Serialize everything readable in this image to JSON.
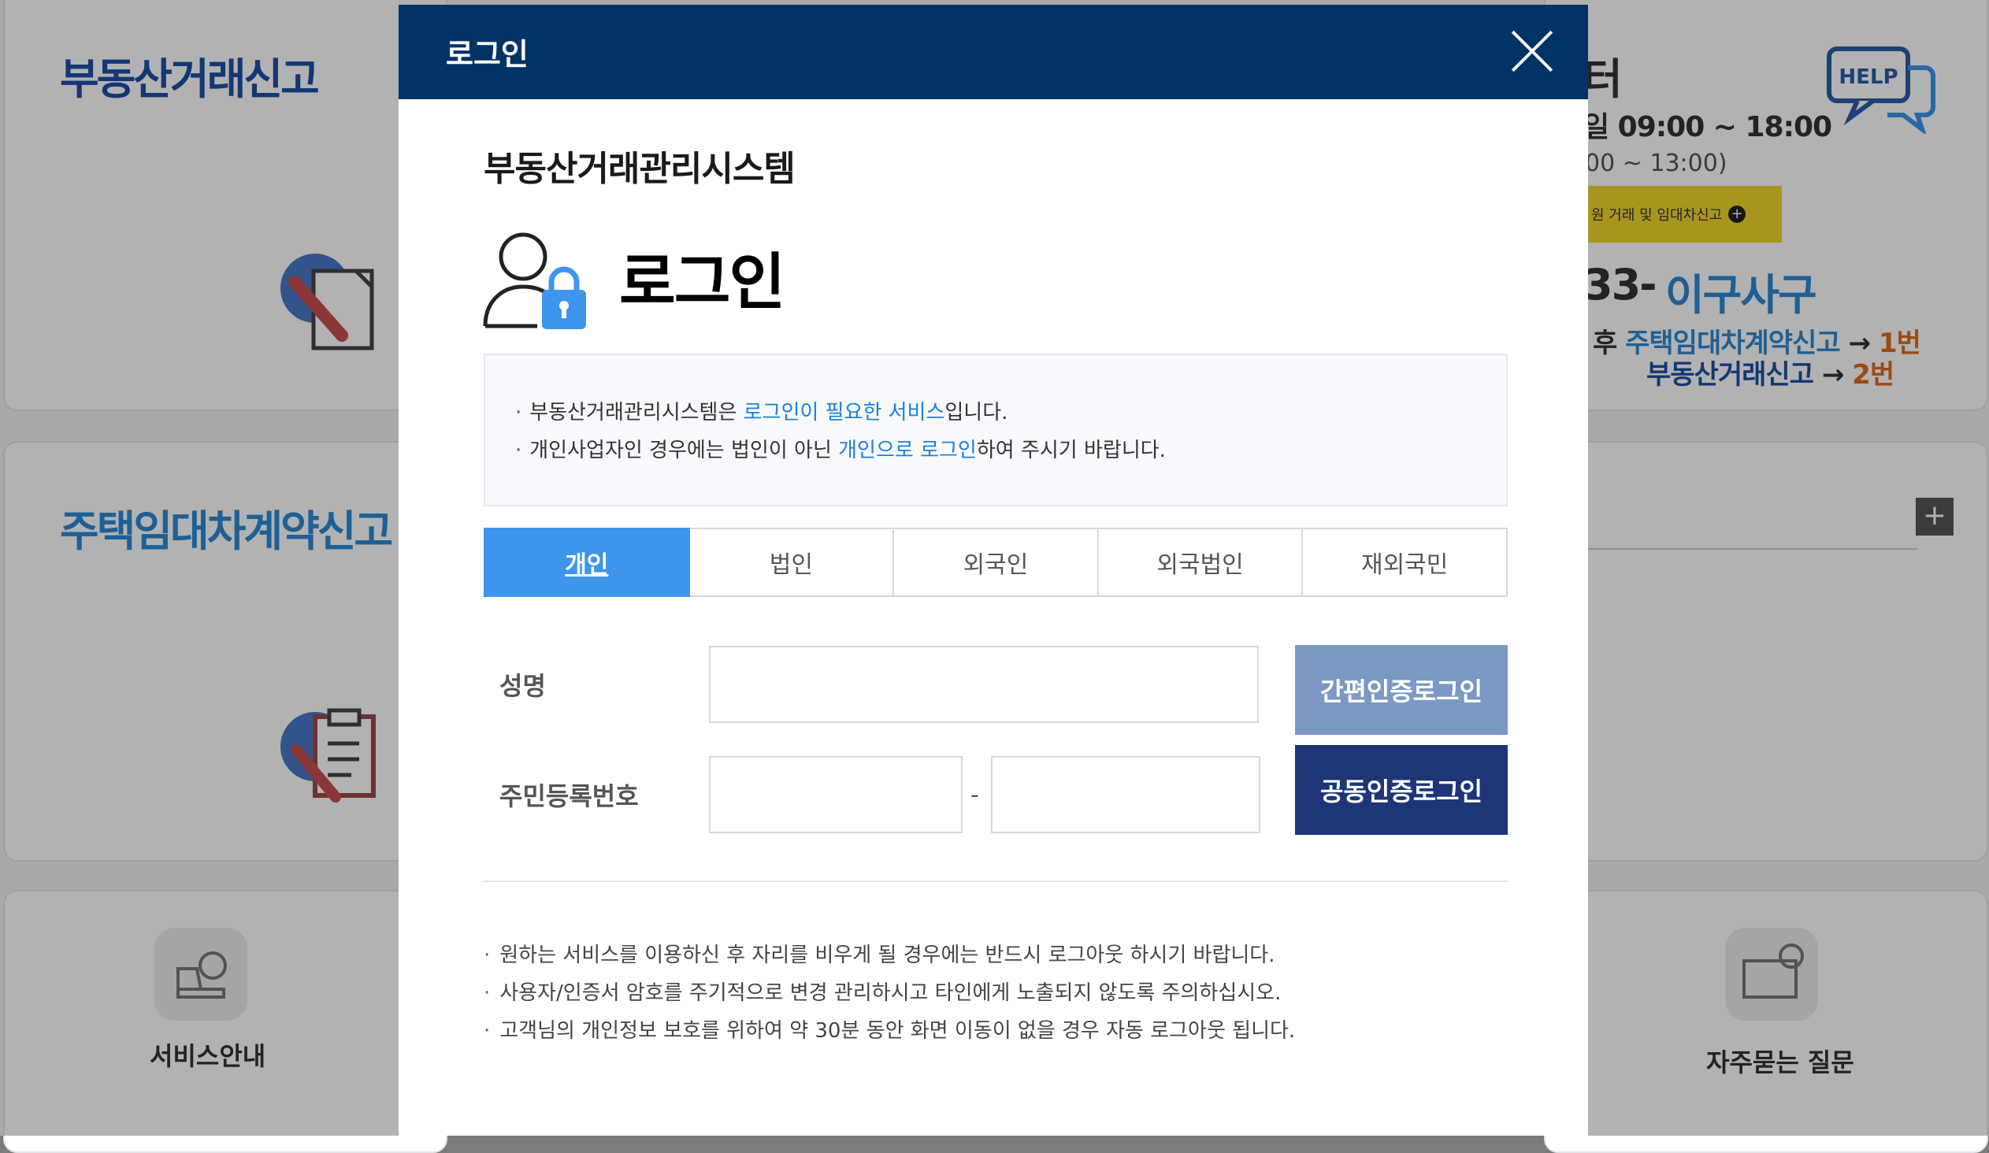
{
  "background": {
    "left_titles": [
      "부동산거래신고",
      "주택임대차계약신고"
    ],
    "help": {
      "partial_title": "터",
      "hours_line": "일 09:00 ~ 18:00",
      "lunch_line": "00 ~ 13:00)",
      "yellow_banner": "원 거래 및 임대차신고",
      "help_badge": "HELP"
    },
    "phone": {
      "number": "33-",
      "slogan": "이구사구",
      "line1_prefix": "후",
      "line1_link": "주택임대차계약신고",
      "line1_arrow": "→",
      "line1_num": "1번",
      "line2_link": "부동산거래신고",
      "line2_arrow": "→",
      "line2_num": "2번"
    },
    "plus_button": "+",
    "bottom_labels": [
      "서비스안내",
      "자주묻는 질문"
    ]
  },
  "modal": {
    "header_title": "로그인",
    "system_name": "부동산거래관리시스템",
    "big_title": "로그인",
    "notice": [
      {
        "dot": "·",
        "before": "부동산거래관리시스템은 ",
        "highlight": "로그인이 필요한 서비스",
        "after": "입니다."
      },
      {
        "dot": "·",
        "before": "개인사업자인 경우에는 법인이 아닌 ",
        "highlight": "개인으로 로그인",
        "after": "하여 주시기 바랍니다."
      }
    ],
    "tabs": [
      "개인",
      "법인",
      "외국인",
      "외국법인",
      "재외국민"
    ],
    "form": {
      "name_label": "성명",
      "rrn_label": "주민등록번호",
      "dash": "-"
    },
    "buttons": {
      "simple_cert": "간편인증로그인",
      "joint_cert": "공동인증로그인"
    },
    "footer_notes": [
      "원하는 서비스를 이용하신 후 자리를 비우게 될 경우에는 반드시 로그아웃 하시기 바랍니다.",
      "사용자/인증서 암호를 주기적으로 변경 관리하시고 타인에게 노출되지 않도록 주의하십시오.",
      "고객님의 개인정보 보호를 위하여 약 30분 동안 화면 이동이 없을 경우 자동 로그아웃 됩니다."
    ],
    "bullet": "·"
  },
  "colors": {
    "header": "#003466",
    "accent": "#3d96ec",
    "highlight": "#1e7fd6",
    "simple_btn": "#7c98c4",
    "cert_btn": "#1e3577"
  }
}
